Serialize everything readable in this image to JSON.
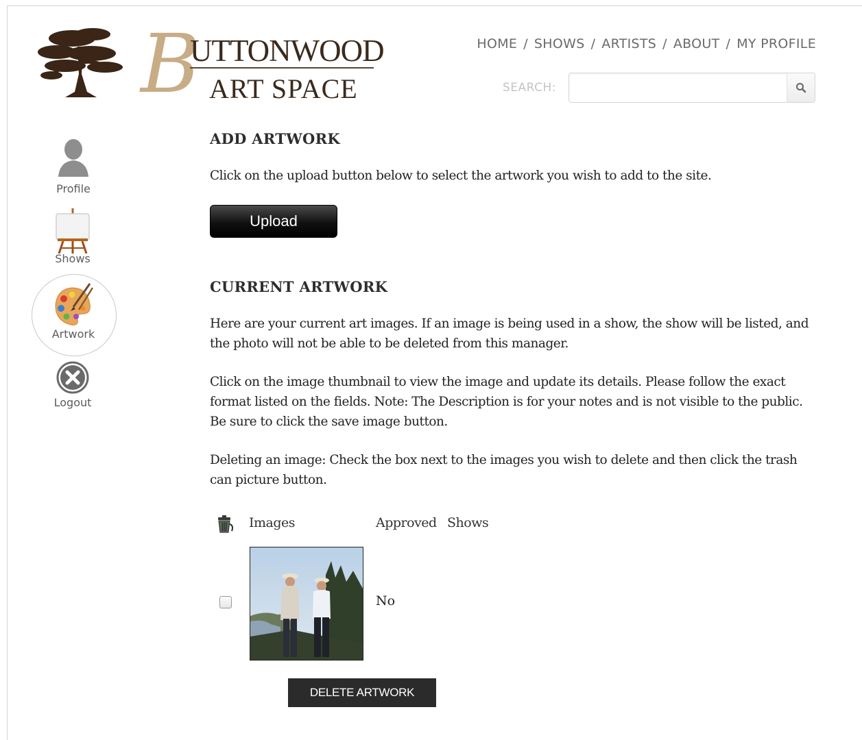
{
  "logo": {
    "letter": "B",
    "line1": "UTTONWOOD",
    "line2": "ART SPACE"
  },
  "nav": {
    "items": [
      "HOME",
      "SHOWS",
      "ARTISTS",
      "ABOUT",
      "MY PROFILE"
    ],
    "separator": "/"
  },
  "search": {
    "label": "SEARCH:",
    "value": "",
    "placeholder": ""
  },
  "sidebar": {
    "items": [
      {
        "label": "Profile",
        "icon": "profile-icon"
      },
      {
        "label": "Shows",
        "icon": "easel-icon"
      },
      {
        "label": "Artwork",
        "icon": "palette-icon",
        "active": true
      },
      {
        "label": "Logout",
        "icon": "close-circle-icon"
      }
    ]
  },
  "add_artwork": {
    "heading": "ADD ARTWORK",
    "instructions": "Click on the upload button below to select the artwork you wish to add to the site.",
    "upload_label": "Upload"
  },
  "current_artwork": {
    "heading": "CURRENT ARTWORK",
    "para1": "Here are your current art images. If an image is being used in a show, the show will be listed, and the photo will not be able to be deleted from this manager.",
    "para2": "Click on the image thumbnail to view the image and update its details. Please follow the exact format listed on the fields. Note: The Description is for your notes and is not visible to the public. Be sure to click the save image button.",
    "para3": "Deleting an image: Check the box next to the images you wish to delete and then click the trash can picture button."
  },
  "table": {
    "trash_icon": "trash-can-icon",
    "headers": {
      "images": "Images",
      "approved": "Approved",
      "shows": "Shows"
    },
    "rows": [
      {
        "checked": false,
        "approved": "No",
        "shows": ""
      }
    ],
    "delete_label": "DELETE ARTWORK"
  },
  "colors": {
    "logo_gold": "#c8ac86",
    "logo_brown": "#3b2a1c",
    "nav_text": "#6a6a6a",
    "button_dark": "#2b2b2b"
  }
}
